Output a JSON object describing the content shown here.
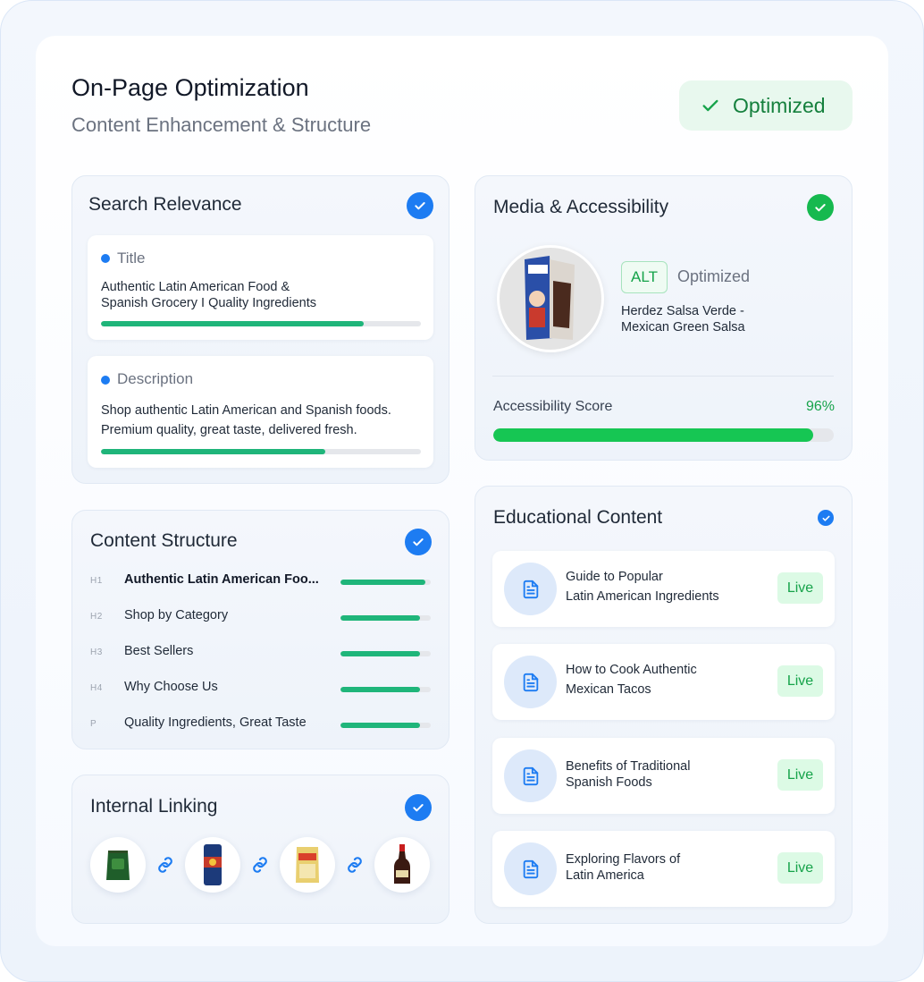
{
  "header": {
    "title": "On-Page Optimization",
    "subtitle": "Content Enhancement & Structure",
    "status_label": "Optimized"
  },
  "search_relevance": {
    "title": "Search Relevance",
    "title_field": {
      "label": "Title",
      "text_line1": "Authentic Latin American Food &",
      "text_line2": "Spanish Grocery I Quality Ingredients",
      "progress": 0.82
    },
    "description_field": {
      "label": "Description",
      "text_line1": "Shop authentic Latin American and Spanish foods.",
      "text_line2": "Premium quality, great taste, delivered fresh.",
      "progress": 0.7
    }
  },
  "content_structure": {
    "title": "Content Structure",
    "headings": [
      {
        "tag": "H1",
        "text": "Authentic Latin American Foo...",
        "progress": 0.94
      },
      {
        "tag": "H2",
        "text": "Shop by Category",
        "progress": 0.88
      },
      {
        "tag": "H3",
        "text": "Best Sellers",
        "progress": 0.88
      },
      {
        "tag": "H4",
        "text": "Why Choose Us",
        "progress": 0.88
      },
      {
        "tag": "P",
        "text": "Quality Ingredients, Great Taste",
        "progress": 0.88
      }
    ]
  },
  "internal_linking": {
    "title": "Internal Linking",
    "products": [
      "green-pouch-product",
      "blue-can-product",
      "yellow-bag-product",
      "soy-sauce-bottle-product"
    ]
  },
  "media_accessibility": {
    "title": "Media & Accessibility",
    "alt_badge": "ALT",
    "alt_status": "Optimized",
    "alt_text_line1": "Herdez Salsa Verde -",
    "alt_text_line2": "Mexican Green Salsa",
    "score_label": "Accessibility Score",
    "score_value": "96%",
    "score": 0.94
  },
  "educational_content": {
    "title": "Educational Content",
    "items": [
      {
        "line1": "Guide to Popular",
        "line2": "Latin American Ingredients",
        "status": "Live"
      },
      {
        "line1": "How to Cook Authentic",
        "line2": "Mexican Tacos",
        "status": "Live"
      },
      {
        "line1": "Benefits of Traditional",
        "line2": "Spanish Foods",
        "status": "Live"
      },
      {
        "line1": "Exploring Flavors of",
        "line2": "Latin America",
        "status": "Live"
      }
    ]
  },
  "colors": {
    "accent_blue": "#1d7cf2",
    "success_green": "#16b94f",
    "bar_green": "#1fb57a"
  }
}
